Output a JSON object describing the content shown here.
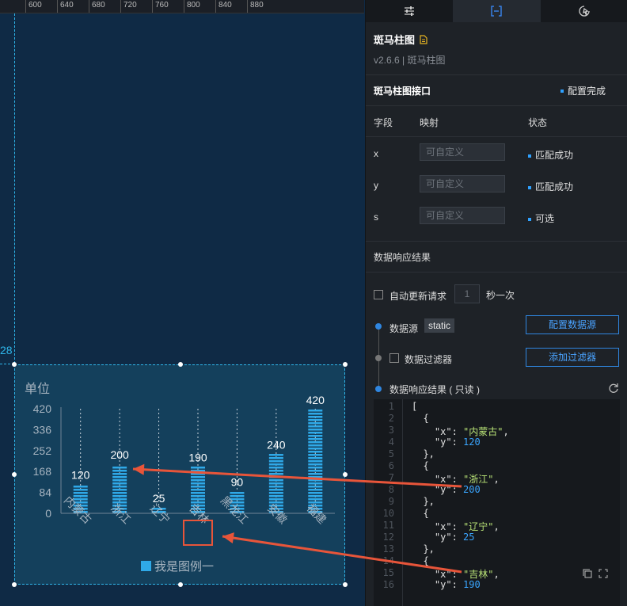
{
  "ruler": {
    "ticks": [
      "600",
      "640",
      "680",
      "720",
      "760",
      "800",
      "840",
      "880"
    ]
  },
  "guide": {
    "label": "28"
  },
  "chart_data": {
    "type": "bar",
    "categories": [
      "内蒙古",
      "浙江",
      "辽宁",
      "吉林",
      "黑龙江",
      "安徽",
      "福建"
    ],
    "values": [
      120,
      200,
      25,
      190,
      90,
      240,
      420
    ],
    "ylabel": "单位",
    "yticks": [
      0,
      84,
      168,
      252,
      336,
      420
    ],
    "ylim": [
      0,
      420
    ],
    "legend": "我是图例一",
    "bar_color": "#2fa9e8",
    "highlighted_category": "吉林",
    "annotation_color": "#e8553a"
  },
  "panel": {
    "tabs": [
      "settings-icon",
      "interface-icon",
      "interaction-icon"
    ],
    "title": "斑马柱图",
    "version": "v2.6.6 | 斑马柱图",
    "interface": {
      "title": "斑马柱图接口",
      "status": "配置完成"
    },
    "columns": [
      "字段",
      "映射",
      "状态"
    ],
    "fields": [
      {
        "name": "x",
        "placeholder": "可自定义",
        "status": "匹配成功"
      },
      {
        "name": "y",
        "placeholder": "可自定义",
        "status": "匹配成功"
      },
      {
        "name": "s",
        "placeholder": "可自定义",
        "status": "可选"
      }
    ],
    "result_title": "数据响应结果",
    "auto_update": {
      "label": "自动更新请求",
      "value": "1",
      "unit": "秒一次"
    },
    "datasource": {
      "label": "数据源",
      "tag": "static",
      "button": "配置数据源"
    },
    "filter": {
      "label": "数据过滤器",
      "button": "添加过滤器"
    },
    "response": {
      "label": "数据响应结果 ( 只读 )"
    },
    "code_lines": [
      "[",
      "  {",
      "    \"x\": \"内蒙古\",",
      "    \"y\": 120",
      "  },",
      "  {",
      "    \"x\": \"浙江\",",
      "    \"y\": 200",
      "  },",
      "  {",
      "    \"x\": \"辽宁\",",
      "    \"y\": 25",
      "  },",
      "  {",
      "    \"x\": \"吉林\",",
      "    \"y\": 190"
    ]
  }
}
